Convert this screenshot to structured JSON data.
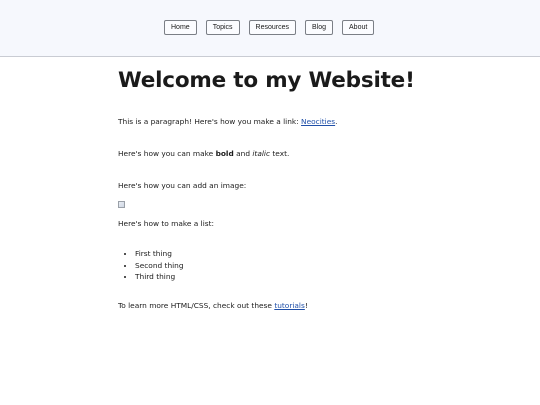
{
  "nav": {
    "items": [
      {
        "label": "Home"
      },
      {
        "label": "Topics"
      },
      {
        "label": "Resources"
      },
      {
        "label": "Blog"
      },
      {
        "label": "About"
      }
    ]
  },
  "main": {
    "title": "Welcome to my Website!",
    "p1_text": "This is a paragraph! Here's how you make a link: ",
    "p1_link": "Neocities",
    "p1_end": ".",
    "p2_before": "Here's how you can make ",
    "p2_bold": "bold",
    "p2_mid": " and ",
    "p2_italic": "italic",
    "p2_end": " text.",
    "p3_text": "Here's how you can add an image:",
    "p4_text": "Here's how to make a list:",
    "list": [
      "First thing",
      "Second thing",
      "Third thing"
    ],
    "p5_text": "To learn more HTML/CSS, check out these ",
    "p5_link": "tutorials",
    "p5_end": "!"
  }
}
